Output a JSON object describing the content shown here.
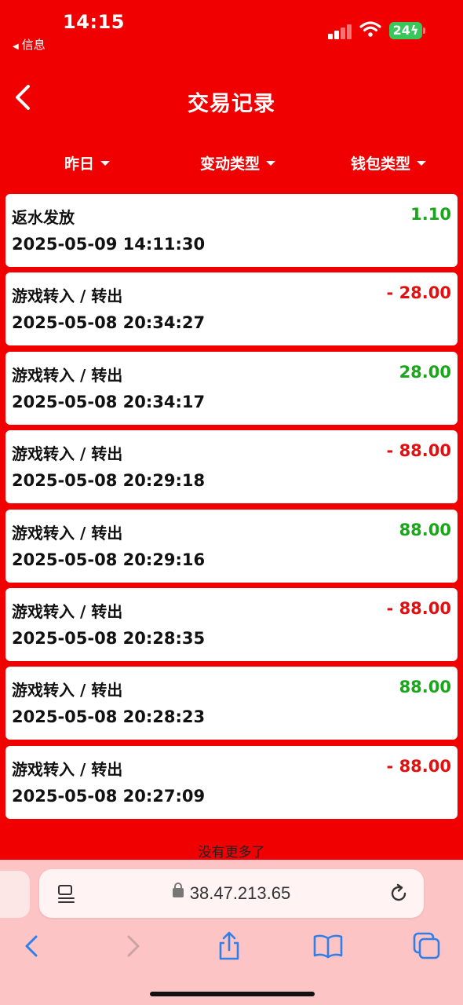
{
  "status": {
    "time": "14:15",
    "back_app": "信息",
    "battery": "24"
  },
  "header": {
    "title": "交易记录"
  },
  "filters": [
    {
      "label": "昨日"
    },
    {
      "label": "变动类型"
    },
    {
      "label": "钱包类型"
    }
  ],
  "transactions": [
    {
      "type": "返水发放",
      "amount": "1.10",
      "datetime": "2025-05-09 14:11:30",
      "direction": "in"
    },
    {
      "type": "游戏转入 / 转出",
      "amount": "- 28.00",
      "datetime": "2025-05-08 20:34:27",
      "direction": "out"
    },
    {
      "type": "游戏转入 / 转出",
      "amount": "28.00",
      "datetime": "2025-05-08 20:34:17",
      "direction": "in"
    },
    {
      "type": "游戏转入 / 转出",
      "amount": "- 88.00",
      "datetime": "2025-05-08 20:29:18",
      "direction": "out"
    },
    {
      "type": "游戏转入 / 转出",
      "amount": "88.00",
      "datetime": "2025-05-08 20:29:16",
      "direction": "in"
    },
    {
      "type": "游戏转入 / 转出",
      "amount": "- 88.00",
      "datetime": "2025-05-08 20:28:35",
      "direction": "out"
    },
    {
      "type": "游戏转入 / 转出",
      "amount": "88.00",
      "datetime": "2025-05-08 20:28:23",
      "direction": "in"
    },
    {
      "type": "游戏转入 / 转出",
      "amount": "- 88.00",
      "datetime": "2025-05-08 20:27:09",
      "direction": "out"
    }
  ],
  "list_end_text": "没有更多了",
  "browser": {
    "url": "38.47.213.65"
  },
  "colors": {
    "background": "#f00000",
    "positive": "#1aa51a",
    "negative": "#e01010",
    "browser_bar": "#fcc4c4",
    "ios_blue": "#2f7fe8"
  }
}
